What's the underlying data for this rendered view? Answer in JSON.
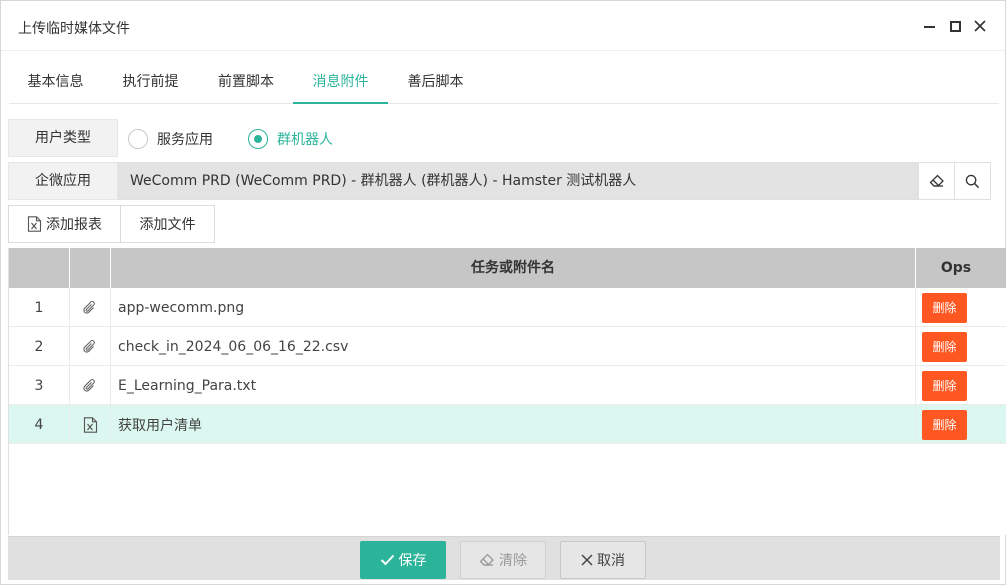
{
  "window": {
    "title": "上传临时媒体文件"
  },
  "tabs": [
    {
      "label": "基本信息",
      "active": false
    },
    {
      "label": "执行前提",
      "active": false
    },
    {
      "label": "前置脚本",
      "active": false
    },
    {
      "label": "消息附件",
      "active": true
    },
    {
      "label": "善后脚本",
      "active": false
    }
  ],
  "user_type": {
    "label": "用户类型",
    "options": [
      {
        "label": "服务应用",
        "checked": false
      },
      {
        "label": "群机器人",
        "checked": true
      }
    ]
  },
  "wecom_app": {
    "label": "企微应用",
    "value": "WeComm PRD (WeComm PRD) - 群机器人 (群机器人) - Hamster 测试机器人",
    "clear_icon": "eraser-icon",
    "search_icon": "search-icon"
  },
  "toolbar": {
    "add_report_label": "添加报表",
    "add_file_label": "添加文件"
  },
  "grid": {
    "headers": {
      "num": "",
      "icon": "",
      "name": "任务或附件名",
      "ops": "Ops"
    },
    "rows": [
      {
        "num": "1",
        "icon": "paperclip-icon",
        "name": "app-wecomm.png",
        "delete_label": "删除",
        "selected": false
      },
      {
        "num": "2",
        "icon": "paperclip-icon",
        "name": "check_in_2024_06_06_16_22.csv",
        "delete_label": "删除",
        "selected": false
      },
      {
        "num": "3",
        "icon": "paperclip-icon",
        "name": "E_Learning_Para.txt",
        "delete_label": "删除",
        "selected": false
      },
      {
        "num": "4",
        "icon": "excel-file-icon",
        "name": "获取用户清单",
        "delete_label": "删除",
        "selected": true
      }
    ]
  },
  "footer": {
    "save_label": "保存",
    "clear_label": "清除",
    "cancel_label": "取消"
  },
  "colors": {
    "accent": "#2bb49a",
    "danger": "#ff5722",
    "selected_row": "#dbf7ef",
    "header_bg": "#c6c6c6"
  }
}
